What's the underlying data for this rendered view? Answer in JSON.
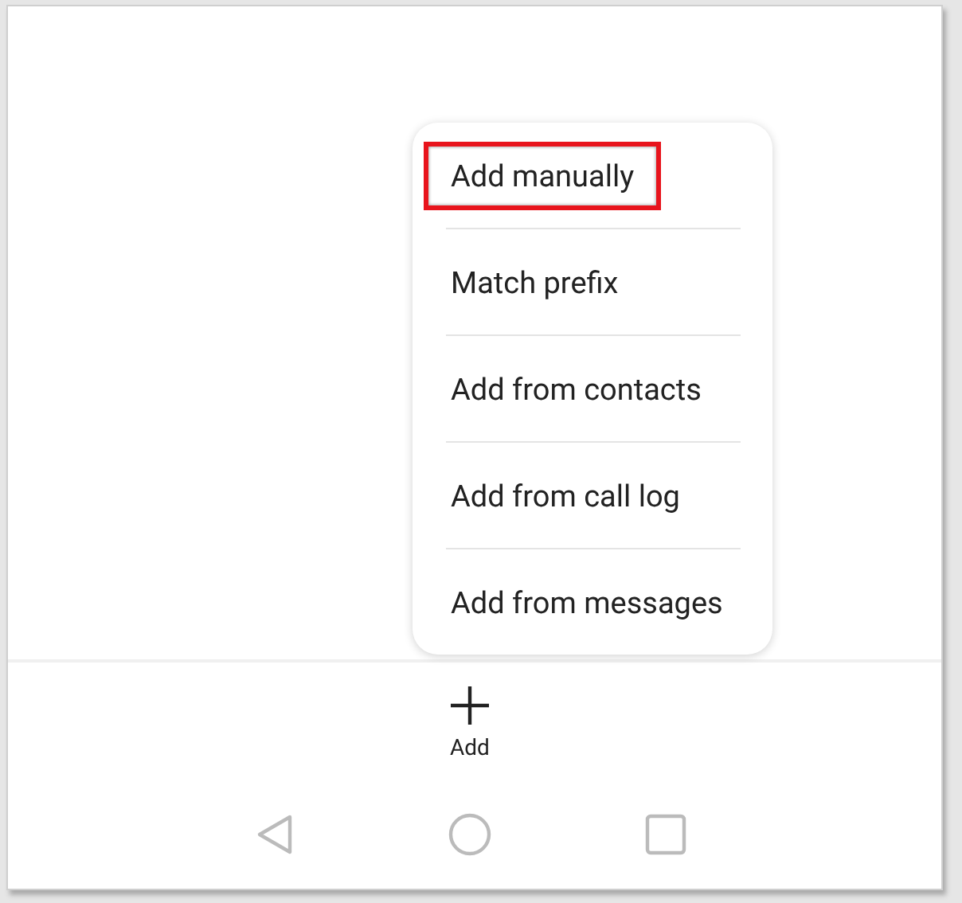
{
  "menu": {
    "items": [
      {
        "label": "Add manually",
        "highlighted": true
      },
      {
        "label": "Match prefix",
        "highlighted": false
      },
      {
        "label": "Add from contacts",
        "highlighted": false
      },
      {
        "label": "Add from call log",
        "highlighted": false
      },
      {
        "label": "Add from messages",
        "highlighted": false
      }
    ]
  },
  "bottom_bar": {
    "add_button": {
      "label": "Add"
    }
  },
  "nav_bar": {
    "buttons": [
      {
        "kind": "back"
      },
      {
        "kind": "home"
      },
      {
        "kind": "recents"
      }
    ]
  }
}
